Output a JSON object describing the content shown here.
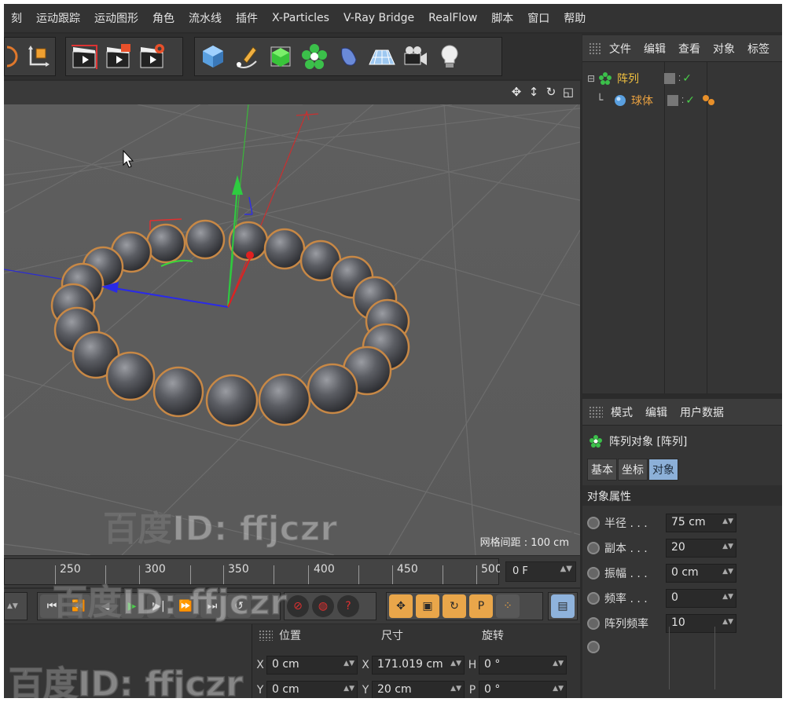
{
  "menu": [
    "刻",
    "运动跟踪",
    "运动图形",
    "角色",
    "流水线",
    "插件",
    "X-Particles",
    "V-Ray Bridge",
    "RealFlow",
    "脚本",
    "窗口",
    "帮助"
  ],
  "viewport": {
    "grid_spacing": "网格间距 : 100 cm"
  },
  "timeline": {
    "ticks": [
      "250",
      "300",
      "350",
      "400",
      "450",
      "500"
    ],
    "current_frame": "0 F"
  },
  "coords": {
    "headers": {
      "position": "位置",
      "size": "尺寸",
      "rotation": "旋转"
    },
    "rows": [
      {
        "pos_axis": "X",
        "pos": "0 cm",
        "size_axis": "X",
        "size": "171.019 cm",
        "rot_axis": "H",
        "rot": "0 °"
      },
      {
        "pos_axis": "Y",
        "pos": "0 cm",
        "size_axis": "Y",
        "size": "20 cm",
        "rot_axis": "P",
        "rot": "0 °"
      }
    ]
  },
  "objects_panel": {
    "tabs": [
      "文件",
      "编辑",
      "查看",
      "对象",
      "标签"
    ],
    "items": [
      {
        "name": "阵列",
        "color": "#f0c040"
      },
      {
        "name": "球体",
        "color": "#e8a040"
      }
    ]
  },
  "attributes_panel": {
    "tabs": [
      "模式",
      "编辑",
      "用户数据"
    ],
    "object_title": "阵列对象 [阵列]",
    "subtabs": [
      "基本",
      "坐标",
      "对象"
    ],
    "active_subtab": "对象",
    "section": "对象属性",
    "fields": [
      {
        "label": "半径 . . .",
        "value": "75 cm"
      },
      {
        "label": "副本 . . .",
        "value": "20"
      },
      {
        "label": "振幅 . . .",
        "value": "0 cm"
      },
      {
        "label": "频率 . . .",
        "value": "0"
      },
      {
        "label": "阵列频率",
        "value": "10"
      }
    ]
  },
  "watermark": "百度ID: ffjczr",
  "colors": {
    "accent_blue": "#8cb0d8",
    "selection_orange": "#e8a040"
  }
}
